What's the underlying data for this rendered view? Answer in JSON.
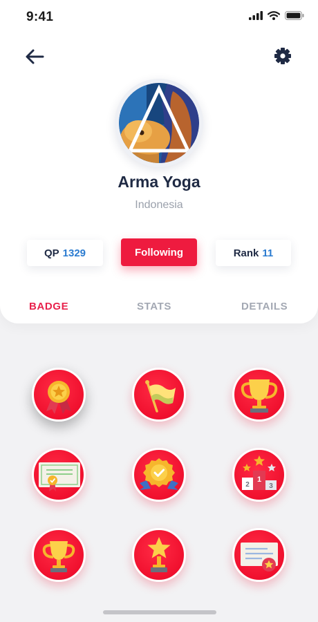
{
  "status_bar": {
    "time": "9:41"
  },
  "header": {
    "back_icon": "arrow-left-icon",
    "settings_icon": "gear-icon"
  },
  "profile": {
    "name": "Arma Yoga",
    "location": "Indonesia"
  },
  "stats": {
    "qp_label": "QP",
    "qp_value": "1329",
    "follow_label": "Following",
    "rank_label": "Rank",
    "rank_value": "11"
  },
  "tabs": [
    {
      "label": "BADGE",
      "active": true
    },
    {
      "label": "STATS",
      "active": false
    },
    {
      "label": "DETAILS",
      "active": false
    }
  ],
  "badges": [
    {
      "icon": "medal-icon",
      "selected": true
    },
    {
      "icon": "flag-icon"
    },
    {
      "icon": "trophy-icon"
    },
    {
      "icon": "certificate-icon"
    },
    {
      "icon": "award-check-icon"
    },
    {
      "icon": "podium-icon",
      "podium_labels": [
        "2",
        "1",
        "3"
      ]
    },
    {
      "icon": "trophy-small-icon"
    },
    {
      "icon": "star-trophy-icon"
    },
    {
      "icon": "document-star-icon"
    }
  ],
  "colors": {
    "accent": "#ee1b3f",
    "badge_bg": "#f0102e",
    "number_blue": "#2a7bd0",
    "text_dark": "#1f2a44"
  }
}
